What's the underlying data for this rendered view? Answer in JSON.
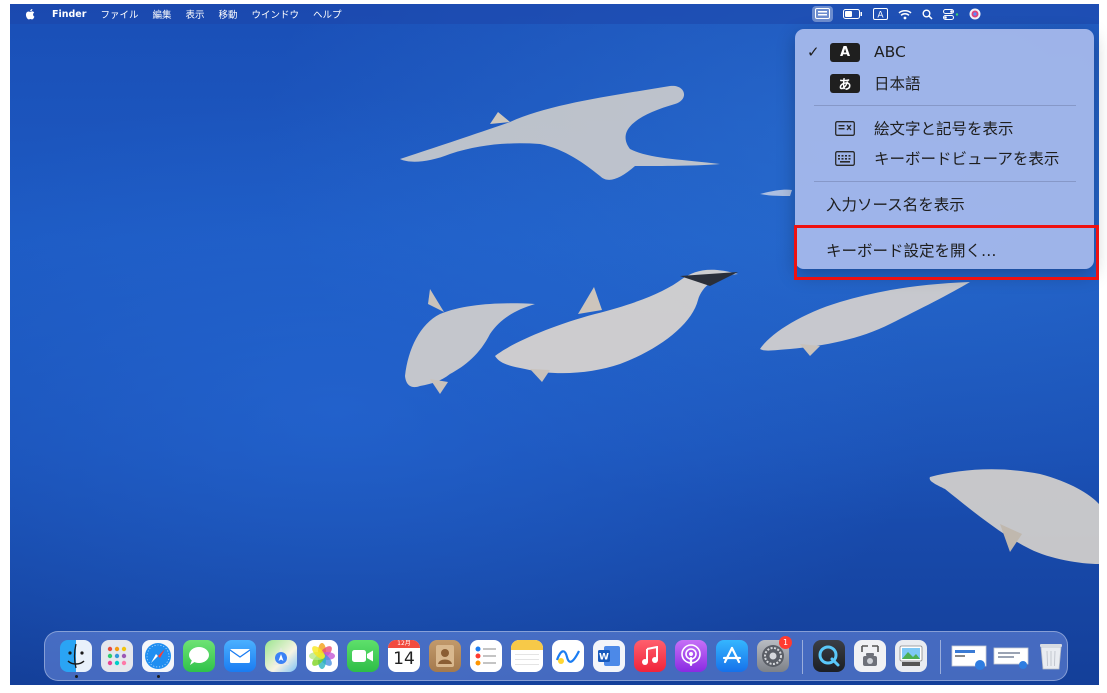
{
  "menubar": {
    "app_name": "Finder",
    "menus": [
      "ファイル",
      "編集",
      "表示",
      "移動",
      "ウインドウ",
      "ヘルプ"
    ],
    "status_icons": [
      "input-source-icon",
      "battery-icon",
      "input-mode-icon",
      "wifi-icon",
      "spotlight-icon",
      "control-center-icon",
      "siri-icon"
    ]
  },
  "input_menu": {
    "sources": [
      {
        "badge": "A",
        "label": "ABC",
        "checked": true
      },
      {
        "badge": "あ",
        "label": "日本語",
        "checked": false
      }
    ],
    "show_emoji": "絵文字と記号を表示",
    "show_keyboard_viewer": "キーボードビューアを表示",
    "show_input_source_name": "入力ソース名を表示",
    "open_keyboard_settings": "キーボード設定を開く…"
  },
  "dock": {
    "calendar": {
      "month": "12月",
      "day": "14"
    },
    "settings_badge": "1",
    "apps": [
      "Finder",
      "Launchpad",
      "Safari",
      "メッセージ",
      "メール",
      "マップ",
      "写真",
      "FaceTime",
      "カレンダー",
      "連絡先",
      "リマインダー",
      "メモ",
      "フリーボード",
      "Word",
      "ミュージック",
      "Podcast",
      "App Store",
      "システム設定",
      "QuickTime Player",
      "スクリーンショット",
      "プレビュー",
      "ダウンロード",
      "書類",
      "ゴミ箱"
    ]
  },
  "colors": {
    "highlight_border": "#ee1111",
    "desktop_blue": "#1d5ac2"
  }
}
